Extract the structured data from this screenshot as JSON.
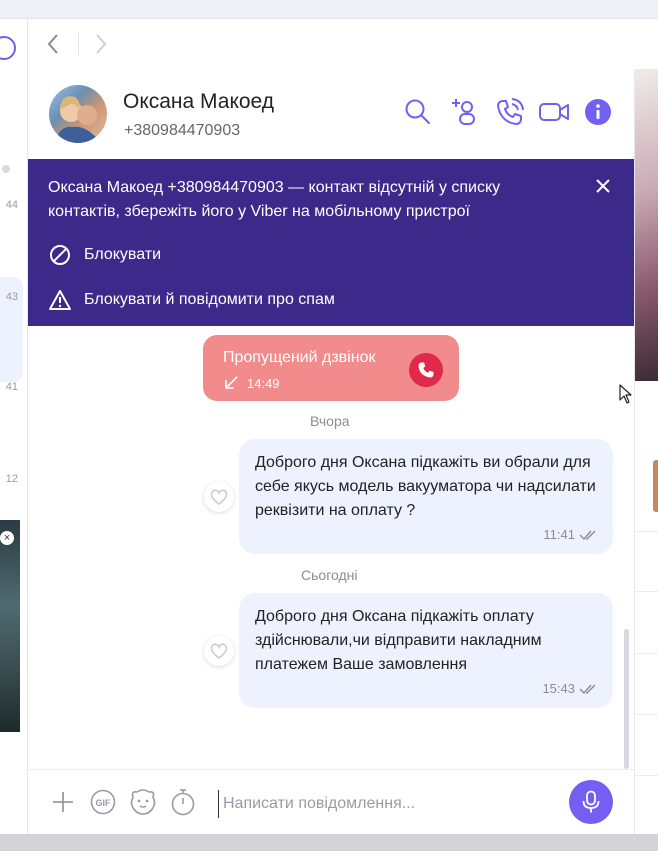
{
  "left_list": {
    "times": [
      "44",
      "43",
      "41",
      "12"
    ]
  },
  "header": {
    "contact_name": "Оксана Макоед",
    "contact_phone": "+380984470903"
  },
  "banner": {
    "message": "Оксана Макоед +380984470903 — контакт відсутній у списку контактів, збережіть його у Viber на мобільному пристрої",
    "block_label": "Блокувати",
    "block_report_label": "Блокувати й повідомити про спам"
  },
  "chat": {
    "missed_call": {
      "title": "Пропущений дзвінок",
      "time": "14:49"
    },
    "date_yesterday": "Вчора",
    "date_today": "Сьогодні",
    "messages": [
      {
        "text": "Доброго дня Оксана підкажіть ви обрали для себе якусь модель вакууматора чи надсилати реквізити на оплату ?",
        "time": "11:41"
      },
      {
        "text": "Доброго дня Оксана підкажіть оплату здійснювали,чи відправити накладним платежем Ваше замовлення",
        "time": "15:43"
      }
    ]
  },
  "composer": {
    "placeholder": "Написати повідомлення..."
  },
  "colors": {
    "accent": "#7360f2",
    "banner_bg": "#3b2a8a",
    "missed_bg": "#f28b8b",
    "missed_icon": "#e0294b",
    "bubble_bg": "#eef2ff"
  },
  "icons": {
    "nav_back": "chevron-left-icon",
    "nav_forward": "chevron-right-icon",
    "search": "search-icon",
    "add_participant": "add-user-icon",
    "voice_call": "phone-icon",
    "video_call": "video-icon",
    "info": "info-icon",
    "close": "close-icon",
    "block": "block-icon",
    "report": "warning-icon",
    "attach": "plus-icon",
    "gif": "gif-icon",
    "sticker": "sticker-icon",
    "timer": "timer-icon",
    "mic": "mic-icon"
  }
}
